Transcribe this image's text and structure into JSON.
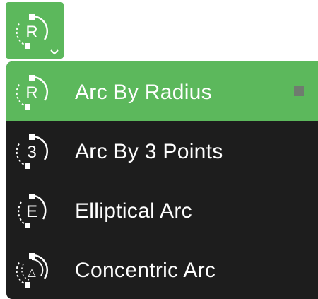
{
  "toolbar": {
    "tool_button": {
      "icon": "arc-radius-icon",
      "glyph": "R",
      "indicator_icon": "chevron-down-icon"
    }
  },
  "menu": {
    "items": [
      {
        "label": "Arc By Radius",
        "icon": "arc-radius-icon",
        "glyph": "R",
        "selected": true,
        "indicator_icon": "square-icon"
      },
      {
        "label": "Arc By 3 Points",
        "icon": "arc-3-points-icon",
        "glyph": "3",
        "selected": false
      },
      {
        "label": "Elliptical Arc",
        "icon": "elliptical-arc-icon",
        "glyph": "E",
        "selected": false
      },
      {
        "label": "Concentric Arc",
        "icon": "concentric-arc-icon",
        "glyph": "△",
        "selected": false
      }
    ]
  },
  "colors": {
    "accent": "#5cb85c",
    "menu_background": "#1d1d1d",
    "text": "#ffffff",
    "indicator": "#6f7b6f"
  }
}
